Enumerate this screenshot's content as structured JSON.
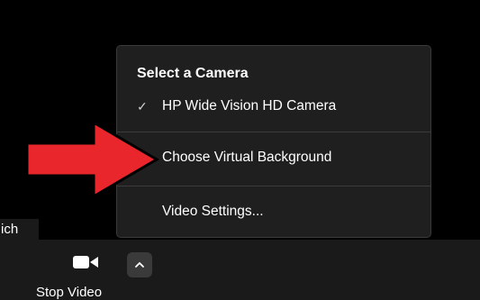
{
  "participant": {
    "name_tag": "ich"
  },
  "toolbar": {
    "stop_video_label": "Stop Video",
    "camera_icon": "video-camera-icon",
    "caret_icon": "chevron-up-icon"
  },
  "camera_menu": {
    "title": "Select a Camera",
    "items": [
      {
        "label": "HP Wide Vision HD Camera",
        "checked": true
      },
      {
        "label": "Choose Virtual Background",
        "checked": false
      },
      {
        "label": "Video Settings...",
        "checked": false
      }
    ]
  },
  "annotation": {
    "arrow_color": "#e8262b",
    "arrow_outline": "#000000"
  }
}
